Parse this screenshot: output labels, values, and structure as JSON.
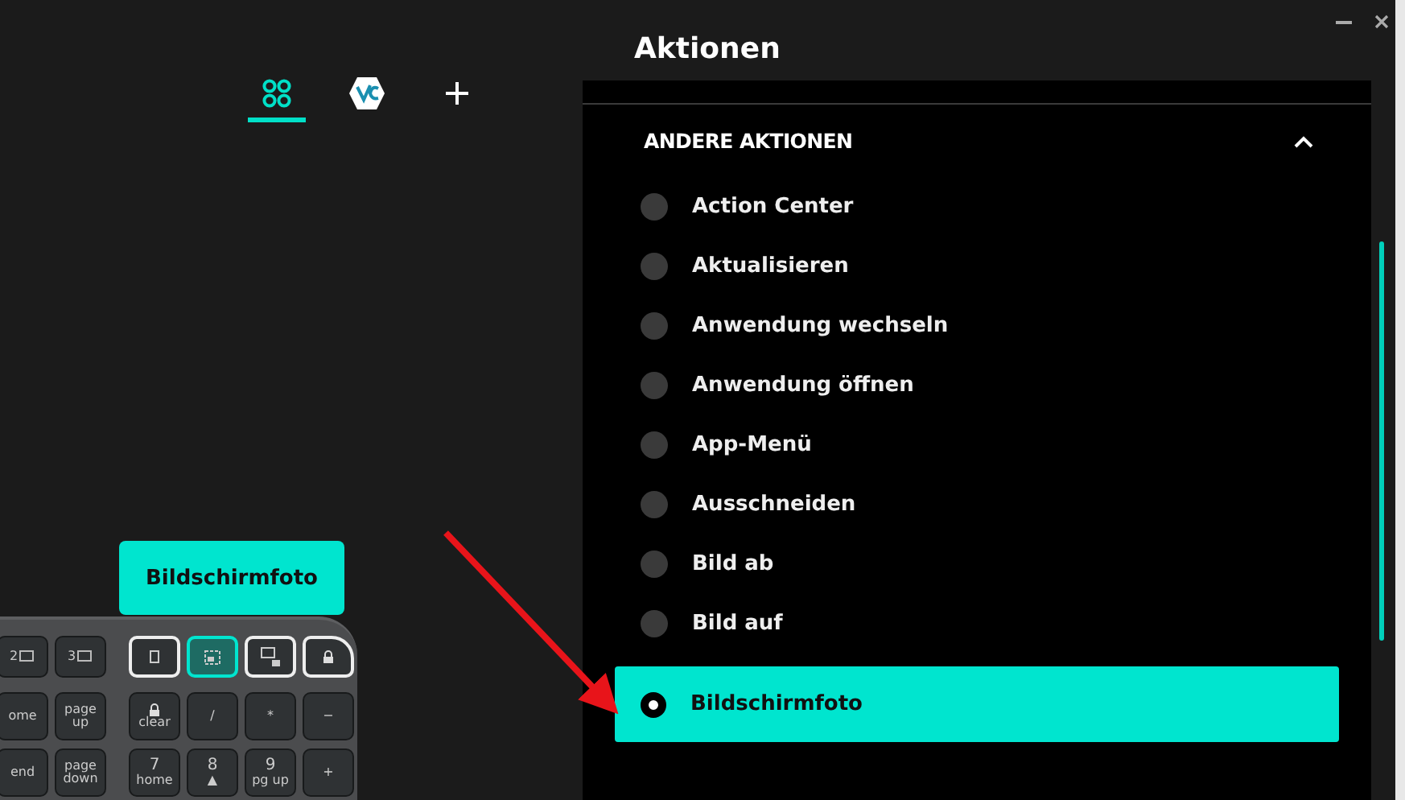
{
  "device_tabs": [
    {
      "kind": "devices",
      "selected": true
    },
    {
      "kind": "app",
      "selected": false
    },
    {
      "kind": "add",
      "selected": false
    }
  ],
  "tooltip": "Bildschirmfoto",
  "keyboard": {
    "fn_keys": [
      {
        "kind": "partial",
        "label": "2"
      },
      {
        "kind": "partial",
        "label": "3"
      },
      {
        "kind": "doc",
        "selected": false
      },
      {
        "kind": "screenshot",
        "selected": true
      },
      {
        "kind": "screenlock",
        "selected": false
      },
      {
        "kind": "lock",
        "selected": false
      }
    ],
    "rows": [
      [
        {
          "label": "ome"
        },
        {
          "label": "page up"
        },
        {
          "label": "clear",
          "lock": true
        },
        {
          "label": "/"
        },
        {
          "label": "*"
        },
        {
          "label": "−"
        }
      ],
      [
        {
          "label": "end"
        },
        {
          "label": "page down"
        },
        {
          "label": "7",
          "sub": "home"
        },
        {
          "label": "8",
          "sub": "▲"
        },
        {
          "label": "9",
          "sub": "pg up"
        },
        {
          "label": "+"
        }
      ]
    ]
  },
  "panel": {
    "title": "Aktionen",
    "section": {
      "title": "ANDERE AKTIONEN",
      "expanded": true
    },
    "actions": [
      {
        "label": "Action Center",
        "selected": false
      },
      {
        "label": "Aktualisieren",
        "selected": false
      },
      {
        "label": "Anwendung wechseln",
        "selected": false
      },
      {
        "label": "Anwendung öffnen",
        "selected": false
      },
      {
        "label": "App-Menü",
        "selected": false
      },
      {
        "label": "Ausschneiden",
        "selected": false
      },
      {
        "label": "Bild ab",
        "selected": false
      },
      {
        "label": "Bild auf",
        "selected": false
      },
      {
        "label": "Bildschirmfoto",
        "selected": true
      }
    ]
  }
}
